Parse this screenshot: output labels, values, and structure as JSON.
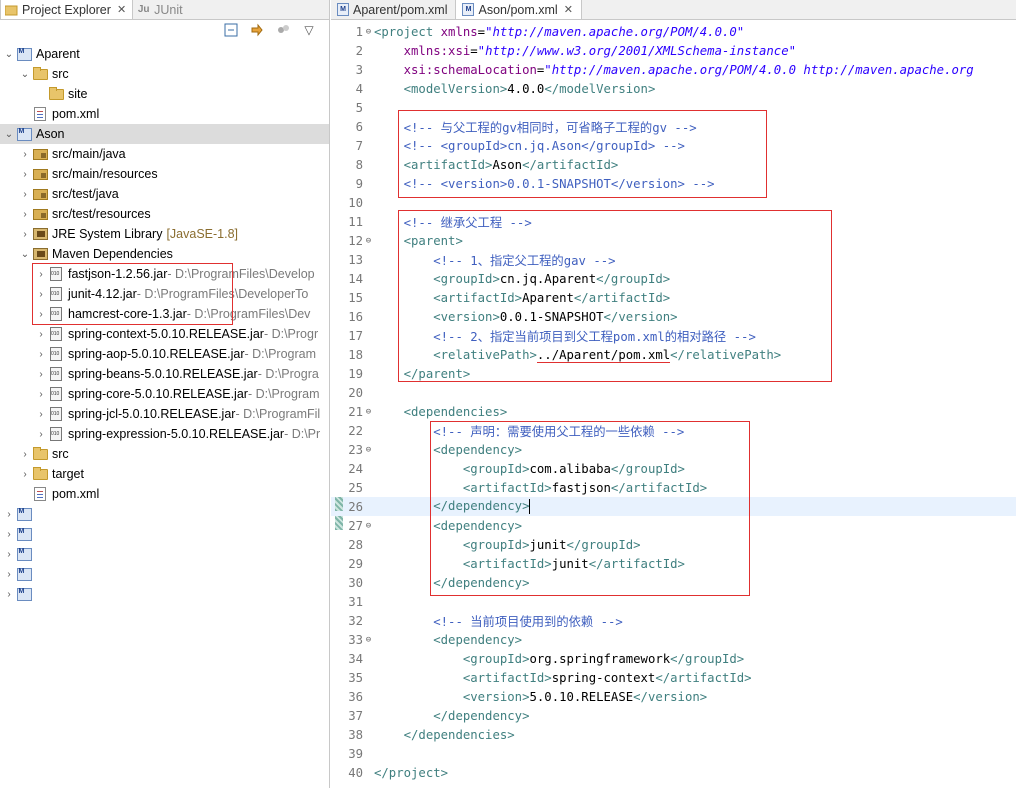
{
  "left_panel": {
    "tabs": [
      {
        "label": "Project Explorer",
        "icon": "folder-tree-icon",
        "active": true
      },
      {
        "label": "JUnit",
        "icon": "junit-icon",
        "active": false
      }
    ],
    "tree": [
      {
        "level": 0,
        "expanded": true,
        "icon": "maven-project-icon",
        "label": "Aparent"
      },
      {
        "level": 1,
        "expanded": true,
        "icon": "folder-icon",
        "label": "src"
      },
      {
        "level": 2,
        "expanded": null,
        "icon": "folder-icon",
        "label": "site"
      },
      {
        "level": 1,
        "expanded": null,
        "icon": "xml-file-icon",
        "label": "pom.xml"
      },
      {
        "level": 0,
        "expanded": true,
        "icon": "maven-project-icon",
        "label": "Ason",
        "selected": true
      },
      {
        "level": 1,
        "expanded": false,
        "icon": "source-folder-icon",
        "label": "src/main/java"
      },
      {
        "level": 1,
        "expanded": false,
        "icon": "source-folder-icon",
        "label": "src/main/resources"
      },
      {
        "level": 1,
        "expanded": false,
        "icon": "source-folder-icon",
        "label": "src/test/java"
      },
      {
        "level": 1,
        "expanded": false,
        "icon": "source-folder-icon",
        "label": "src/test/resources"
      },
      {
        "level": 1,
        "expanded": false,
        "icon": "library-icon",
        "label": "JRE System Library",
        "decoration": "[JavaSE-1.8]"
      },
      {
        "level": 1,
        "expanded": true,
        "icon": "library-icon",
        "label": "Maven Dependencies"
      },
      {
        "level": 2,
        "expanded": false,
        "icon": "jar-icon",
        "label": "fastjson-1.2.56.jar",
        "decoration": " - D:\\ProgramFiles\\Develop"
      },
      {
        "level": 2,
        "expanded": false,
        "icon": "jar-icon",
        "label": "junit-4.12.jar",
        "decoration": " - D:\\ProgramFiles\\DeveloperTo"
      },
      {
        "level": 2,
        "expanded": false,
        "icon": "jar-icon",
        "label": "hamcrest-core-1.3.jar",
        "decoration": " - D:\\ProgramFiles\\Dev"
      },
      {
        "level": 2,
        "expanded": false,
        "icon": "jar-icon",
        "label": "spring-context-5.0.10.RELEASE.jar",
        "decoration": " - D:\\Progr"
      },
      {
        "level": 2,
        "expanded": false,
        "icon": "jar-icon",
        "label": "spring-aop-5.0.10.RELEASE.jar",
        "decoration": " - D:\\Program"
      },
      {
        "level": 2,
        "expanded": false,
        "icon": "jar-icon",
        "label": "spring-beans-5.0.10.RELEASE.jar",
        "decoration": " - D:\\Progra"
      },
      {
        "level": 2,
        "expanded": false,
        "icon": "jar-icon",
        "label": "spring-core-5.0.10.RELEASE.jar",
        "decoration": " - D:\\Program"
      },
      {
        "level": 2,
        "expanded": false,
        "icon": "jar-icon",
        "label": "spring-jcl-5.0.10.RELEASE.jar",
        "decoration": " - D:\\ProgramFil"
      },
      {
        "level": 2,
        "expanded": false,
        "icon": "jar-icon",
        "label": "spring-expression-5.0.10.RELEASE.jar",
        "decoration": " - D:\\Pr"
      },
      {
        "level": 1,
        "expanded": false,
        "icon": "folder-icon",
        "label": "src"
      },
      {
        "level": 1,
        "expanded": false,
        "icon": "folder-icon",
        "label": "target"
      },
      {
        "level": 1,
        "expanded": null,
        "icon": "xml-file-icon",
        "label": "pom.xml"
      },
      {
        "level": 0,
        "expanded": false,
        "icon": "maven-project-icon",
        "label": ""
      },
      {
        "level": 0,
        "expanded": false,
        "icon": "maven-project-icon",
        "label": ""
      },
      {
        "level": 0,
        "expanded": false,
        "icon": "maven-project-icon",
        "label": ""
      },
      {
        "level": 0,
        "expanded": false,
        "icon": "maven-project-icon",
        "label": ""
      },
      {
        "level": 0,
        "expanded": false,
        "icon": "maven-project-icon",
        "label": ""
      }
    ]
  },
  "editor": {
    "tabs": [
      {
        "label": "Aparent/pom.xml",
        "active": false
      },
      {
        "label": "Ason/pom.xml",
        "active": true
      }
    ],
    "lines": [
      {
        "n": "1",
        "fold": "⊖",
        "parts": [
          [
            "tag",
            "<project "
          ],
          [
            "attr",
            "xmlns"
          ],
          [
            "txt",
            "="
          ],
          [
            "str",
            "\"http://maven.apache.org/POM/4.0.0\""
          ]
        ]
      },
      {
        "n": "2",
        "parts": [
          [
            "txt",
            "    "
          ],
          [
            "attr",
            "xmlns:xsi"
          ],
          [
            "txt",
            "="
          ],
          [
            "str",
            "\"http://www.w3.org/2001/XMLSchema-instance\""
          ]
        ]
      },
      {
        "n": "3",
        "parts": [
          [
            "txt",
            "    "
          ],
          [
            "attr",
            "xsi:schemaLocation"
          ],
          [
            "txt",
            "="
          ],
          [
            "str",
            "\"http://maven.apache.org/POM/4.0.0 http://maven.apache.org"
          ]
        ]
      },
      {
        "n": "4",
        "parts": [
          [
            "txt",
            "    "
          ],
          [
            "tag",
            "<modelVersion>"
          ],
          [
            "txt",
            "4.0.0"
          ],
          [
            "tag",
            "</modelVersion>"
          ]
        ]
      },
      {
        "n": "5",
        "parts": []
      },
      {
        "n": "6",
        "parts": [
          [
            "txt",
            "    "
          ],
          [
            "cmt",
            "<!-- 与父工程的gv相同时，可省略子工程的gv -->"
          ]
        ]
      },
      {
        "n": "7",
        "parts": [
          [
            "txt",
            "    "
          ],
          [
            "cmt",
            "<!-- <groupId>cn.jq.Ason</groupId> -->"
          ]
        ]
      },
      {
        "n": "8",
        "parts": [
          [
            "txt",
            "    "
          ],
          [
            "tag",
            "<artifactId>"
          ],
          [
            "txt",
            "Ason"
          ],
          [
            "tag",
            "</artifactId>"
          ]
        ]
      },
      {
        "n": "9",
        "parts": [
          [
            "txt",
            "    "
          ],
          [
            "cmt",
            "<!-- <version>0.0.1-SNAPSHOT</version> -->"
          ]
        ]
      },
      {
        "n": "10",
        "parts": []
      },
      {
        "n": "11",
        "parts": [
          [
            "txt",
            "    "
          ],
          [
            "cmt",
            "<!-- 继承父工程 -->"
          ]
        ]
      },
      {
        "n": "12",
        "fold": "⊖",
        "parts": [
          [
            "txt",
            "    "
          ],
          [
            "tag",
            "<parent>"
          ]
        ]
      },
      {
        "n": "13",
        "parts": [
          [
            "txt",
            "        "
          ],
          [
            "cmt",
            "<!-- 1、指定父工程的gav -->"
          ]
        ]
      },
      {
        "n": "14",
        "parts": [
          [
            "txt",
            "        "
          ],
          [
            "tag",
            "<groupId>"
          ],
          [
            "txt",
            "cn.jq.Aparent"
          ],
          [
            "tag",
            "</groupId>"
          ]
        ]
      },
      {
        "n": "15",
        "parts": [
          [
            "txt",
            "        "
          ],
          [
            "tag",
            "<artifactId>"
          ],
          [
            "txt",
            "Aparent"
          ],
          [
            "tag",
            "</artifactId>"
          ]
        ]
      },
      {
        "n": "16",
        "parts": [
          [
            "txt",
            "        "
          ],
          [
            "tag",
            "<version>"
          ],
          [
            "txt",
            "0.0.1-SNAPSHOT"
          ],
          [
            "tag",
            "</version>"
          ]
        ]
      },
      {
        "n": "17",
        "parts": [
          [
            "txt",
            "        "
          ],
          [
            "cmt",
            "<!-- 2、指定当前项目到父工程pom.xml的相对路径 -->"
          ]
        ]
      },
      {
        "n": "18",
        "parts": [
          [
            "txt",
            "        "
          ],
          [
            "tag",
            "<relativePath>"
          ],
          [
            "txt",
            "../Aparent/pom.xml"
          ],
          [
            "tag",
            "</relativePath>"
          ]
        ]
      },
      {
        "n": "19",
        "parts": [
          [
            "txt",
            "    "
          ],
          [
            "tag",
            "</parent>"
          ]
        ]
      },
      {
        "n": "20",
        "parts": []
      },
      {
        "n": "21",
        "fold": "⊖",
        "parts": [
          [
            "txt",
            "    "
          ],
          [
            "tag",
            "<dependencies>"
          ]
        ]
      },
      {
        "n": "22",
        "parts": [
          [
            "txt",
            "        "
          ],
          [
            "cmt",
            "<!-- 声明：需要使用父工程的一些依赖 -->"
          ]
        ]
      },
      {
        "n": "23",
        "fold": "⊖",
        "parts": [
          [
            "txt",
            "        "
          ],
          [
            "tag",
            "<dependency>"
          ]
        ]
      },
      {
        "n": "24",
        "parts": [
          [
            "txt",
            "            "
          ],
          [
            "tag",
            "<groupId>"
          ],
          [
            "txt",
            "com.alibaba"
          ],
          [
            "tag",
            "</groupId>"
          ]
        ]
      },
      {
        "n": "25",
        "parts": [
          [
            "txt",
            "            "
          ],
          [
            "tag",
            "<artifactId>"
          ],
          [
            "txt",
            "fastjson"
          ],
          [
            "tag",
            "</artifactId>"
          ]
        ]
      },
      {
        "n": "26",
        "current": true,
        "parts": [
          [
            "txt",
            "        "
          ],
          [
            "tag",
            "</dependency>"
          ]
        ]
      },
      {
        "n": "27",
        "fold": "⊖",
        "parts": [
          [
            "txt",
            "        "
          ],
          [
            "tag",
            "<dependency>"
          ]
        ]
      },
      {
        "n": "28",
        "parts": [
          [
            "txt",
            "            "
          ],
          [
            "tag",
            "<groupId>"
          ],
          [
            "txt",
            "junit"
          ],
          [
            "tag",
            "</groupId>"
          ]
        ]
      },
      {
        "n": "29",
        "parts": [
          [
            "txt",
            "            "
          ],
          [
            "tag",
            "<artifactId>"
          ],
          [
            "txt",
            "junit"
          ],
          [
            "tag",
            "</artifactId>"
          ]
        ]
      },
      {
        "n": "30",
        "parts": [
          [
            "txt",
            "        "
          ],
          [
            "tag",
            "</dependency>"
          ]
        ]
      },
      {
        "n": "31",
        "parts": []
      },
      {
        "n": "32",
        "parts": [
          [
            "txt",
            "        "
          ],
          [
            "cmt",
            "<!-- 当前项目使用到的依赖 -->"
          ]
        ]
      },
      {
        "n": "33",
        "fold": "⊖",
        "parts": [
          [
            "txt",
            "        "
          ],
          [
            "tag",
            "<dependency>"
          ]
        ]
      },
      {
        "n": "34",
        "parts": [
          [
            "txt",
            "            "
          ],
          [
            "tag",
            "<groupId>"
          ],
          [
            "txt",
            "org.springframework"
          ],
          [
            "tag",
            "</groupId>"
          ]
        ]
      },
      {
        "n": "35",
        "parts": [
          [
            "txt",
            "            "
          ],
          [
            "tag",
            "<artifactId>"
          ],
          [
            "txt",
            "spring-context"
          ],
          [
            "tag",
            "</artifactId>"
          ]
        ]
      },
      {
        "n": "36",
        "parts": [
          [
            "txt",
            "            "
          ],
          [
            "tag",
            "<version>"
          ],
          [
            "txt",
            "5.0.10.RELEASE"
          ],
          [
            "tag",
            "</version>"
          ]
        ]
      },
      {
        "n": "37",
        "parts": [
          [
            "txt",
            "        "
          ],
          [
            "tag",
            "</dependency>"
          ]
        ]
      },
      {
        "n": "38",
        "parts": [
          [
            "txt",
            "    "
          ],
          [
            "tag",
            "</dependencies>"
          ]
        ]
      },
      {
        "n": "39",
        "parts": []
      },
      {
        "n": "40",
        "parts": [
          [
            "tag",
            "</project>"
          ]
        ]
      }
    ]
  },
  "colors": {
    "tag": "#3f7f7f",
    "attr": "#7f007f",
    "string": "#2a00ff",
    "comment": "#3f5fbf",
    "highlight_box": "#e03030"
  }
}
